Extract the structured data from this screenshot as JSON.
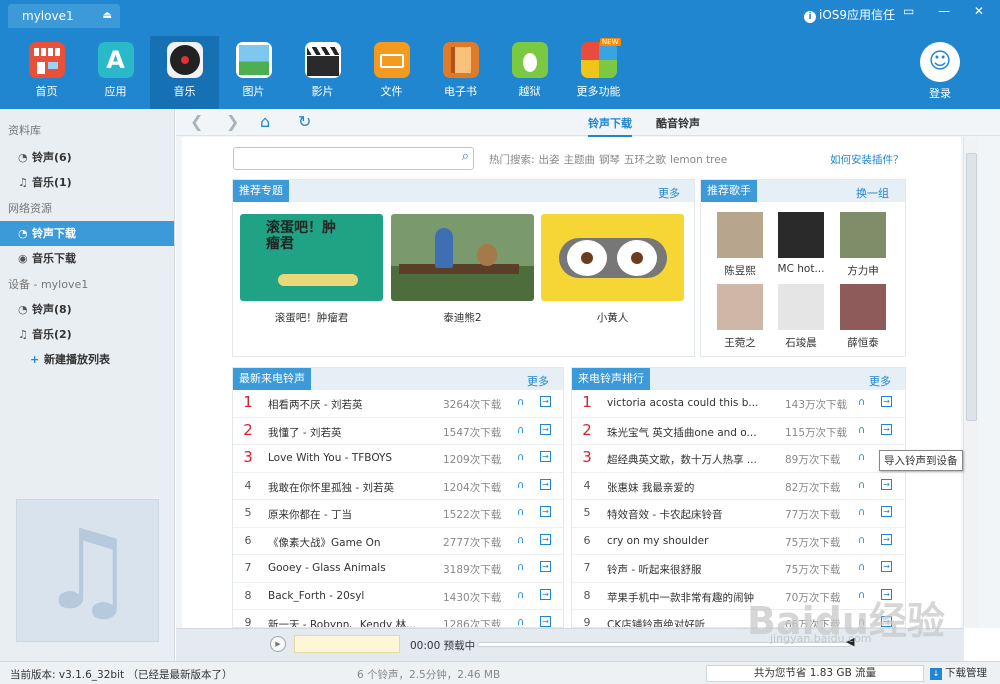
{
  "titlebar": {
    "device": "mylove1",
    "trust": "iOS9应用信任",
    "win_controls": "▭ — ✕"
  },
  "nav": {
    "items": [
      {
        "label": "首页",
        "icon": "store-icon",
        "color": "#e8503a"
      },
      {
        "label": "应用",
        "icon": "app-store-icon",
        "color": "#2bb8c8"
      },
      {
        "label": "音乐",
        "icon": "music-disc-icon",
        "color": "#222222"
      },
      {
        "label": "图片",
        "icon": "photo-icon",
        "color": "#4caf50"
      },
      {
        "label": "影片",
        "icon": "clapperboard-icon",
        "color": "#2a2a2a"
      },
      {
        "label": "文件",
        "icon": "folder-icon",
        "color": "#f39a1f"
      },
      {
        "label": "电子书",
        "icon": "book-icon",
        "color": "#e07a2b"
      },
      {
        "label": "越狱",
        "icon": "pineapple-icon",
        "color": "#7bc943"
      },
      {
        "label": "更多功能",
        "icon": "more-grid-icon",
        "color": "#f0c419",
        "badge": "NEW"
      }
    ],
    "login": "登录"
  },
  "sidebar": {
    "lib_title": "资料库",
    "lib": [
      {
        "label": "铃声(6)"
      },
      {
        "label": "音乐(1)"
      }
    ],
    "net_title": "网络资源",
    "net": [
      {
        "label": "铃声下载"
      },
      {
        "label": "音乐下载"
      }
    ],
    "dev_title": "设备 - mylove1",
    "dev": [
      {
        "label": "铃声(8)"
      },
      {
        "label": "音乐(2)"
      },
      {
        "label": "新建播放列表"
      }
    ]
  },
  "toolbar": {
    "tabs": [
      "铃声下载",
      "酷音铃声"
    ]
  },
  "search": {
    "placeholder": "",
    "hot_label": "热门搜索:",
    "hot": [
      "出姿",
      "主题曲",
      "钢琴",
      "五环之歌",
      "lemon tree"
    ],
    "howto": "如何安装插件？"
  },
  "featured": {
    "title": "推荐专题",
    "more": "更多",
    "cards": [
      {
        "caption": "滚蛋吧！肿瘤君",
        "art": "滚蛋吧！肿瘤君"
      },
      {
        "caption": "泰迪熊2"
      },
      {
        "caption": "小黄人"
      }
    ]
  },
  "singers": {
    "title": "推荐歌手",
    "change": "换一组",
    "items": [
      "陈昱熙",
      "MC hot...",
      "方力申",
      "王菀之",
      "石竣晨",
      "薛恒泰"
    ]
  },
  "latest": {
    "title": "最新来电铃声",
    "more": "更多",
    "rows": [
      {
        "n": "1",
        "name": "相看两不厌 - 刘若英",
        "dl": "3264次下载"
      },
      {
        "n": "2",
        "name": "我懂了 - 刘若英",
        "dl": "1547次下载"
      },
      {
        "n": "3",
        "name": "Love With You - TFBOYS",
        "dl": "1209次下载"
      },
      {
        "n": "4",
        "name": "我敢在你怀里孤独 - 刘若英",
        "dl": "1204次下载"
      },
      {
        "n": "5",
        "name": "原来你都在 - 丁当",
        "dl": "1522次下载"
      },
      {
        "n": "6",
        "name": "《像素大战》Game On",
        "dl": "2777次下载"
      },
      {
        "n": "7",
        "name": "Gooey - Glass Animals",
        "dl": "3189次下载"
      },
      {
        "n": "8",
        "name": "Back_Forth - 20syl",
        "dl": "1430次下载"
      },
      {
        "n": "9",
        "name": "新一天 - Robynn、Kendy 林...",
        "dl": "1286次下载"
      }
    ]
  },
  "ranking": {
    "title": "来电铃声排行",
    "more": "更多",
    "rows": [
      {
        "n": "1",
        "name": "victoria acosta could this b...",
        "dl": "143万次下载"
      },
      {
        "n": "2",
        "name": "珠光宝气 英文插曲one and o...",
        "dl": "115万次下载"
      },
      {
        "n": "3",
        "name": "超经典英文歌，数十万人热享 ...",
        "dl": "89万次下载"
      },
      {
        "n": "4",
        "name": "张惠妹 我最亲爱的",
        "dl": "82万次下载"
      },
      {
        "n": "5",
        "name": "特效音效 - 卡农起床铃音",
        "dl": "77万次下载"
      },
      {
        "n": "6",
        "name": "cry on my shoulder",
        "dl": "75万次下载"
      },
      {
        "n": "7",
        "name": "铃声 - 听起来很舒服",
        "dl": "75万次下载"
      },
      {
        "n": "8",
        "name": "苹果手机中一款非常有趣的闹钟",
        "dl": "70万次下载"
      },
      {
        "n": "9",
        "name": "CK店铺铃声绝对好听",
        "dl": "66万次下载"
      }
    ]
  },
  "tooltip": "导入铃声到设备",
  "player": {
    "time": "00:00",
    "status": "预载中"
  },
  "status": {
    "version": "当前版本: v3.1.6_32bit （已经是最新版本了）",
    "count": "6 个铃声，2.5分钟，2.46 MB",
    "saved": "共为您节省 1.83 GB 流量",
    "download": "下载管理"
  },
  "watermark": {
    "text": "Baidu经验",
    "url": "jingyan.baidu.com"
  }
}
